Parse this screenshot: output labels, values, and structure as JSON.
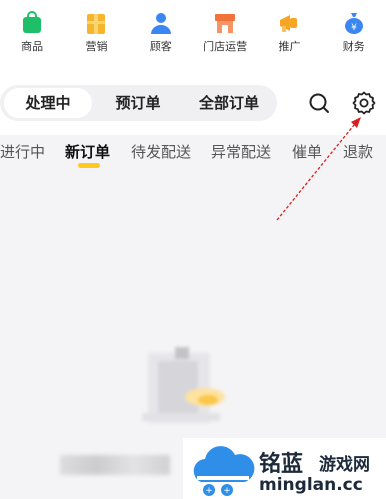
{
  "nav_grid": [
    {
      "label": "商品",
      "icon": "shopping-bag-icon",
      "color": "#1fbf6a"
    },
    {
      "label": "营销",
      "icon": "gift-icon",
      "color": "#f6b52a"
    },
    {
      "label": "顾客",
      "icon": "customer-icon",
      "color": "#3b86f0"
    },
    {
      "label": "门店运营",
      "icon": "store-icon",
      "color": "#f2733a"
    },
    {
      "label": "推广",
      "icon": "megaphone-icon",
      "color": "#f6a623"
    },
    {
      "label": "财务",
      "icon": "money-bag-icon",
      "color": "#3b86f0"
    }
  ],
  "segment": {
    "tabs": [
      "处理中",
      "预订单",
      "全部订单"
    ],
    "active": "处理中"
  },
  "status_tabs": {
    "items": [
      "进行中",
      "新订单",
      "待发配送",
      "异常配送",
      "催单",
      "退款"
    ],
    "active": "新订单",
    "accent": "#ffc81e"
  },
  "watermark": {
    "line1_cn": "铭蓝",
    "line1_cn2": "游戏网",
    "line2": "minglan.cc"
  }
}
